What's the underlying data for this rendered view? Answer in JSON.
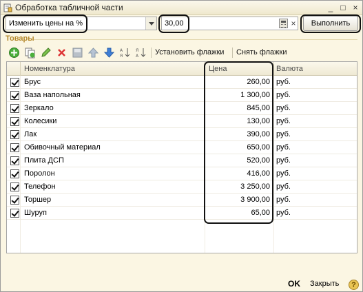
{
  "window": {
    "title": "Обработка табличной части",
    "buttons": {
      "minimize": "_",
      "maximize": "□",
      "close": "×"
    }
  },
  "action": {
    "operation_value": "Изменить цены на %",
    "number_value": "30,00",
    "clear_glyph": "×",
    "run_label": "Выполнить"
  },
  "section_title": "Товары",
  "toolbar": {
    "set_flags_label": "Установить флажки",
    "clear_flags_label": "Снять флажки",
    "icons": [
      "add-icon",
      "copy-icon",
      "edit-icon",
      "delete-icon",
      "save-icon",
      "move-up-icon",
      "move-down-icon",
      "sort-asc-icon",
      "sort-desc-icon"
    ]
  },
  "table": {
    "columns": [
      "Номенклатура",
      "Цена",
      "Валюта"
    ],
    "rows": [
      {
        "checked": true,
        "name": "Брус",
        "price": "260,00",
        "currency": "руб."
      },
      {
        "checked": true,
        "name": "Ваза напольная",
        "price": "1 300,00",
        "currency": "руб."
      },
      {
        "checked": true,
        "name": "Зеркало",
        "price": "845,00",
        "currency": "руб."
      },
      {
        "checked": true,
        "name": "Колесики",
        "price": "130,00",
        "currency": "руб."
      },
      {
        "checked": true,
        "name": "Лак",
        "price": "390,00",
        "currency": "руб."
      },
      {
        "checked": true,
        "name": "Обивочный материал",
        "price": "650,00",
        "currency": "руб."
      },
      {
        "checked": true,
        "name": "Плита ДСП",
        "price": "520,00",
        "currency": "руб."
      },
      {
        "checked": true,
        "name": "Поролон",
        "price": "416,00",
        "currency": "руб."
      },
      {
        "checked": true,
        "name": "Телефон",
        "price": "3 250,00",
        "currency": "руб."
      },
      {
        "checked": true,
        "name": "Торшер",
        "price": "3 900,00",
        "currency": "руб."
      },
      {
        "checked": true,
        "name": "Шуруп",
        "price": "65,00",
        "currency": "руб."
      }
    ]
  },
  "footer": {
    "ok_label": "OK",
    "close_label": "Закрыть",
    "help_glyph": "?"
  },
  "colors": {
    "section_title": "#b5882a",
    "window_bg": "#fbf6e3",
    "highlight_outline": "#111111"
  }
}
